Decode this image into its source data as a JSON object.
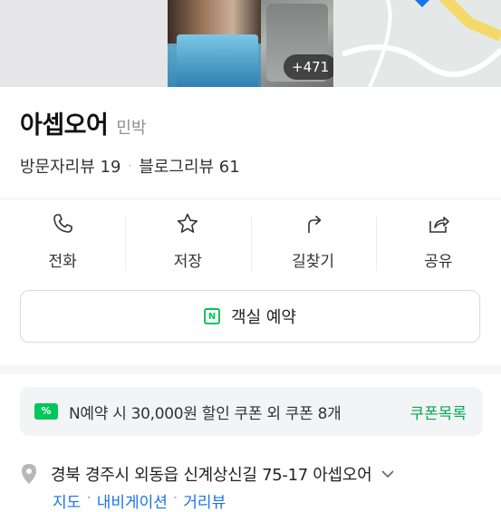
{
  "gallery": {
    "photo_count": "+471"
  },
  "place": {
    "name": "아셉오어",
    "category": "민박"
  },
  "reviews": {
    "visitor_label": "방문자리뷰 19",
    "separator": "·",
    "blog_label": "블로그리뷰 61"
  },
  "actions": [
    {
      "label": "전화",
      "icon": "phone-icon"
    },
    {
      "label": "저장",
      "icon": "star-icon"
    },
    {
      "label": "길찾기",
      "icon": "directions-icon"
    },
    {
      "label": "공유",
      "icon": "share-icon"
    }
  ],
  "reserve": {
    "badge": "N",
    "label": "객실 예약"
  },
  "coupon": {
    "badge": "%",
    "text": "N예약 시 30,000원 할인 쿠폰 외 쿠폰 8개",
    "link": "쿠폰목록"
  },
  "address": {
    "text": "경북 경주시 외동읍 신계상신길 75-17 아셉오어",
    "links": [
      "지도",
      "내비게이션",
      "거리뷰"
    ],
    "link_separator": "·"
  },
  "colors": {
    "accent": "#03c75a",
    "link": "#1a73e8",
    "map_road": "#f6d86a",
    "map_pin": "#1a73e8"
  }
}
